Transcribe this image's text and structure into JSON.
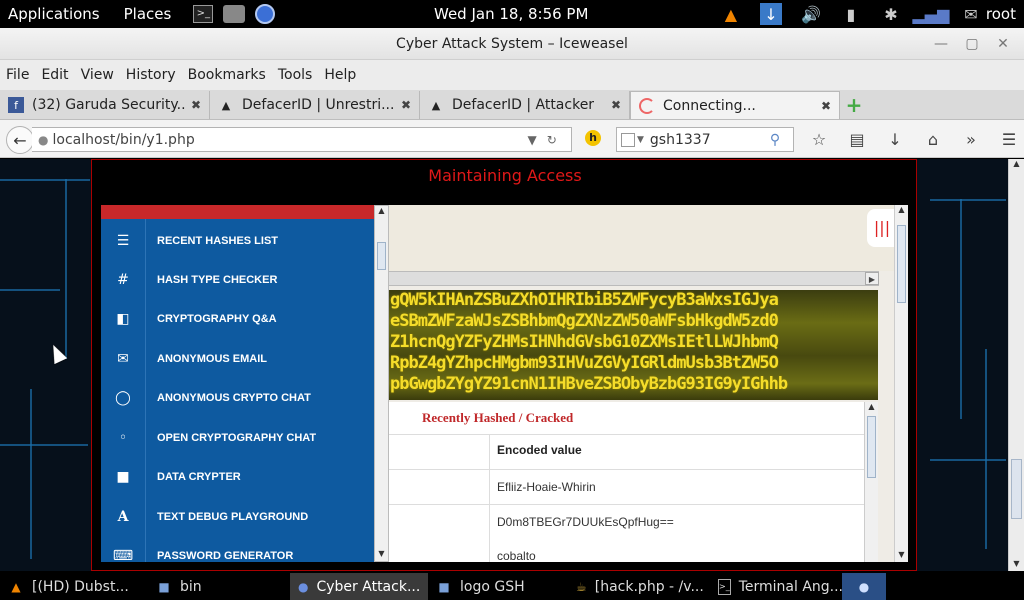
{
  "top_panel": {
    "applications": "Applications",
    "places": "Places",
    "clock": "Wed Jan 18,  8:56 PM",
    "user": "root"
  },
  "window": {
    "title": "Cyber Attack System – Iceweasel"
  },
  "menubar": [
    "File",
    "Edit",
    "View",
    "History",
    "Bookmarks",
    "Tools",
    "Help"
  ],
  "tabs": [
    {
      "label": "(32) Garuda Security...",
      "icon": "facebook-icon"
    },
    {
      "label": "DefacerID | Unrestri...",
      "icon": "hat-icon"
    },
    {
      "label": "DefacerID | Attacker",
      "icon": "hat-icon"
    },
    {
      "label": "Connecting...",
      "icon": "loading-icon"
    }
  ],
  "navbar": {
    "url": "localhost/bin/y1.php",
    "search": "gsh1337",
    "hbadge": "h"
  },
  "page": {
    "title": "Maintaining Access",
    "sidebar": [
      {
        "label": "RECENT HASHES LIST",
        "icon": "list-icon"
      },
      {
        "label": "HASH TYPE CHECKER",
        "icon": "hash-icon"
      },
      {
        "label": "CRYPTOGRAPHY Q&A",
        "icon": "qa-icon"
      },
      {
        "label": "ANONYMOUS EMAIL",
        "icon": "envelope-icon"
      },
      {
        "label": "ANONYMOUS CRYPTO CHAT",
        "icon": "chat-icon"
      },
      {
        "label": "OPEN CRYPTOGRAPHY CHAT",
        "icon": "chats-icon"
      },
      {
        "label": "DATA CRYPTER",
        "icon": "lock-icon"
      },
      {
        "label": "TEXT DEBUG PLAYGROUND",
        "icon": "font-icon"
      },
      {
        "label": "PASSWORD GENERATOR",
        "icon": "keyboard-icon"
      }
    ],
    "banner_lines": [
      "gQW5kIHAnZSBuZXhOIHRIbiB5ZWFycyB3aWxsIGJya",
      "eSBmZWFzaWJsZSBhbmQgZXNzZW50aWFsbHkgdW5zd0",
      "Z1hcnQgYZFyZHMsIHNhdGVsbG10ZXMsIEtlLWJhbmQ",
      "RpbZ4gYZhpcHMgbm93IHVuZGVyIGRldmUsb3BtZW5O",
      "pbGwgbZYgYZ91cnN1IHBveZSBObyBzbG93IG9yIGhhb"
    ],
    "card": {
      "title": "Recently Hashed / Cracked",
      "column": "Encoded value",
      "rows": [
        "Efliiz-Hoaie-Whirin",
        "D0m8TBEGr7DUUkEsQpfHug==",
        "cobalto"
      ]
    }
  },
  "taskbar": [
    {
      "label": "[(HD) Dubst...",
      "icon": "vlc-icon"
    },
    {
      "label": "bin",
      "icon": "folder-icon"
    },
    {
      "label": "Cyber Attack...",
      "icon": "browser-icon"
    },
    {
      "label": "logo GSH",
      "icon": "folder-icon"
    },
    {
      "label": "[hack.php - /v...",
      "icon": "teapot-icon"
    },
    {
      "label": "Terminal Ang...",
      "icon": "terminal-icon"
    }
  ],
  "colors": {
    "accent_red": "#e01818",
    "sidebar_blue": "#0e5aa0",
    "banner_yellow": "#f5dd2a"
  }
}
